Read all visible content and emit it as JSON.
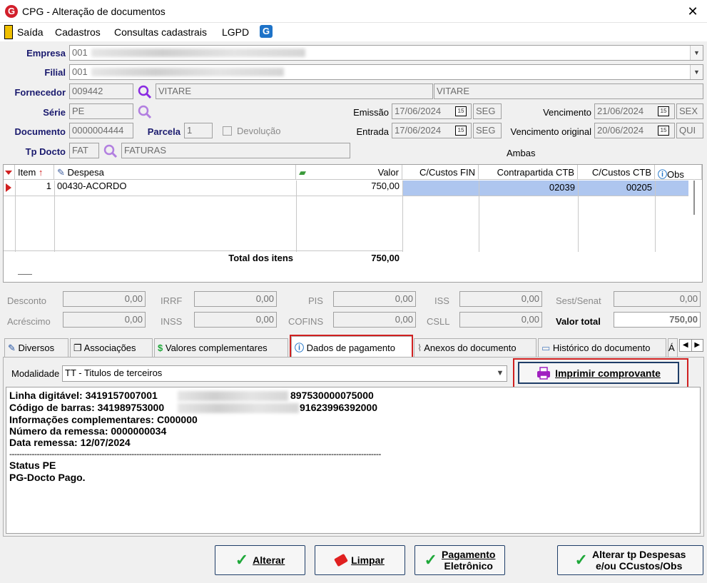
{
  "window": {
    "title": "CPG - Alteração de documentos",
    "close_label": "✕"
  },
  "menu": {
    "items": [
      "Saída",
      "Cadastros",
      "Consultas cadastrais",
      "LGPD"
    ]
  },
  "form": {
    "empresa_label": "Empresa",
    "empresa_value": "001",
    "filial_label": "Filial",
    "filial_value": "001",
    "fornecedor_label": "Fornecedor",
    "fornecedor_code": "009442",
    "fornecedor_name": "VITARE",
    "fornecedor_name2": "VITARE",
    "serie_label": "Série",
    "serie_value": "PE",
    "documento_label": "Documento",
    "documento_value": "0000004444",
    "parcela_label": "Parcela",
    "parcela_value": "1",
    "devolucao_label": "Devolução",
    "tpdocto_label": "Tp Docto",
    "tpdocto_code": "FAT",
    "tpdocto_name": "FATURAS",
    "emissao_label": "Emissão",
    "emissao_value": "17/06/2024",
    "emissao_day": "SEG",
    "entrada_label": "Entrada",
    "entrada_value": "17/06/2024",
    "entrada_day": "SEG",
    "vencimento_label": "Vencimento",
    "vencimento_value": "21/06/2024",
    "vencimento_day": "SEX",
    "vencimento_original_label": "Vencimento original",
    "vencimento_original_value": "20/06/2024",
    "vencimento_original_day": "QUI",
    "ambas_label": "Ambas",
    "calendar_glyph": "15"
  },
  "grid": {
    "columns": [
      "Item",
      "Despesa",
      "Valor",
      "C/Custos FIN",
      "Contrapartida CTB",
      "C/Custos CTB",
      "Obs"
    ],
    "row": {
      "item": "1",
      "despesa": "00430-ACORDO",
      "valor": "750,00",
      "ccustos_fin": "",
      "contrapartida": "02039",
      "ccustos_ctb": "00205"
    },
    "total_label": "Total dos itens",
    "total_value": "750,00"
  },
  "totals": {
    "desconto_label": "Desconto",
    "desconto": "0,00",
    "acrescimo_label": "Acréscimo",
    "acrescimo": "0,00",
    "irrf_label": "IRRF",
    "irrf": "0,00",
    "inss_label": "INSS",
    "inss": "0,00",
    "pis_label": "PIS",
    "pis": "0,00",
    "cofins_label": "COFINS",
    "cofins": "0,00",
    "iss_label": "ISS",
    "iss": "0,00",
    "csll_label": "CSLL",
    "csll": "0,00",
    "sest_label": "Sest/Senat",
    "sest": "0,00",
    "valor_total_label": "Valor total",
    "valor_total": "750,00"
  },
  "tabs": [
    "Diversos",
    "Associações",
    "Valores complementares",
    "Dados de pagamento",
    "Anexos do documento",
    "Histórico do documento"
  ],
  "payment": {
    "modalidade_label": "Modalidade",
    "modalidade_value": "TT  - Titulos de terceiros",
    "print_button": "Imprimir comprovante",
    "lines": {
      "linha_digitavel_a": "Linha digitável: 3419157007001",
      "linha_digitavel_b": "897530000075000",
      "codigo_barras_a": "Código de barras: 341989753000",
      "codigo_barras_b": "91623996392000",
      "info_comp": "Informações complementares: C000000",
      "numero_remessa": "Número da remessa: 0000000034",
      "data_remessa": "Data remessa: 12/07/2024",
      "separator": "-----------------------------------------------------------------------------------------------------------------------------------------------------",
      "status": "Status PE",
      "pg": "PG-Docto Pago."
    }
  },
  "buttons": {
    "alterar": "Alterar",
    "limpar": "Limpar",
    "pagamento_1": "Pagamento",
    "pagamento_2": "Eletrônico",
    "alterar_tp_1": "Alterar tp Despesas",
    "alterar_tp_2": "e/ou CCustos/Obs"
  }
}
